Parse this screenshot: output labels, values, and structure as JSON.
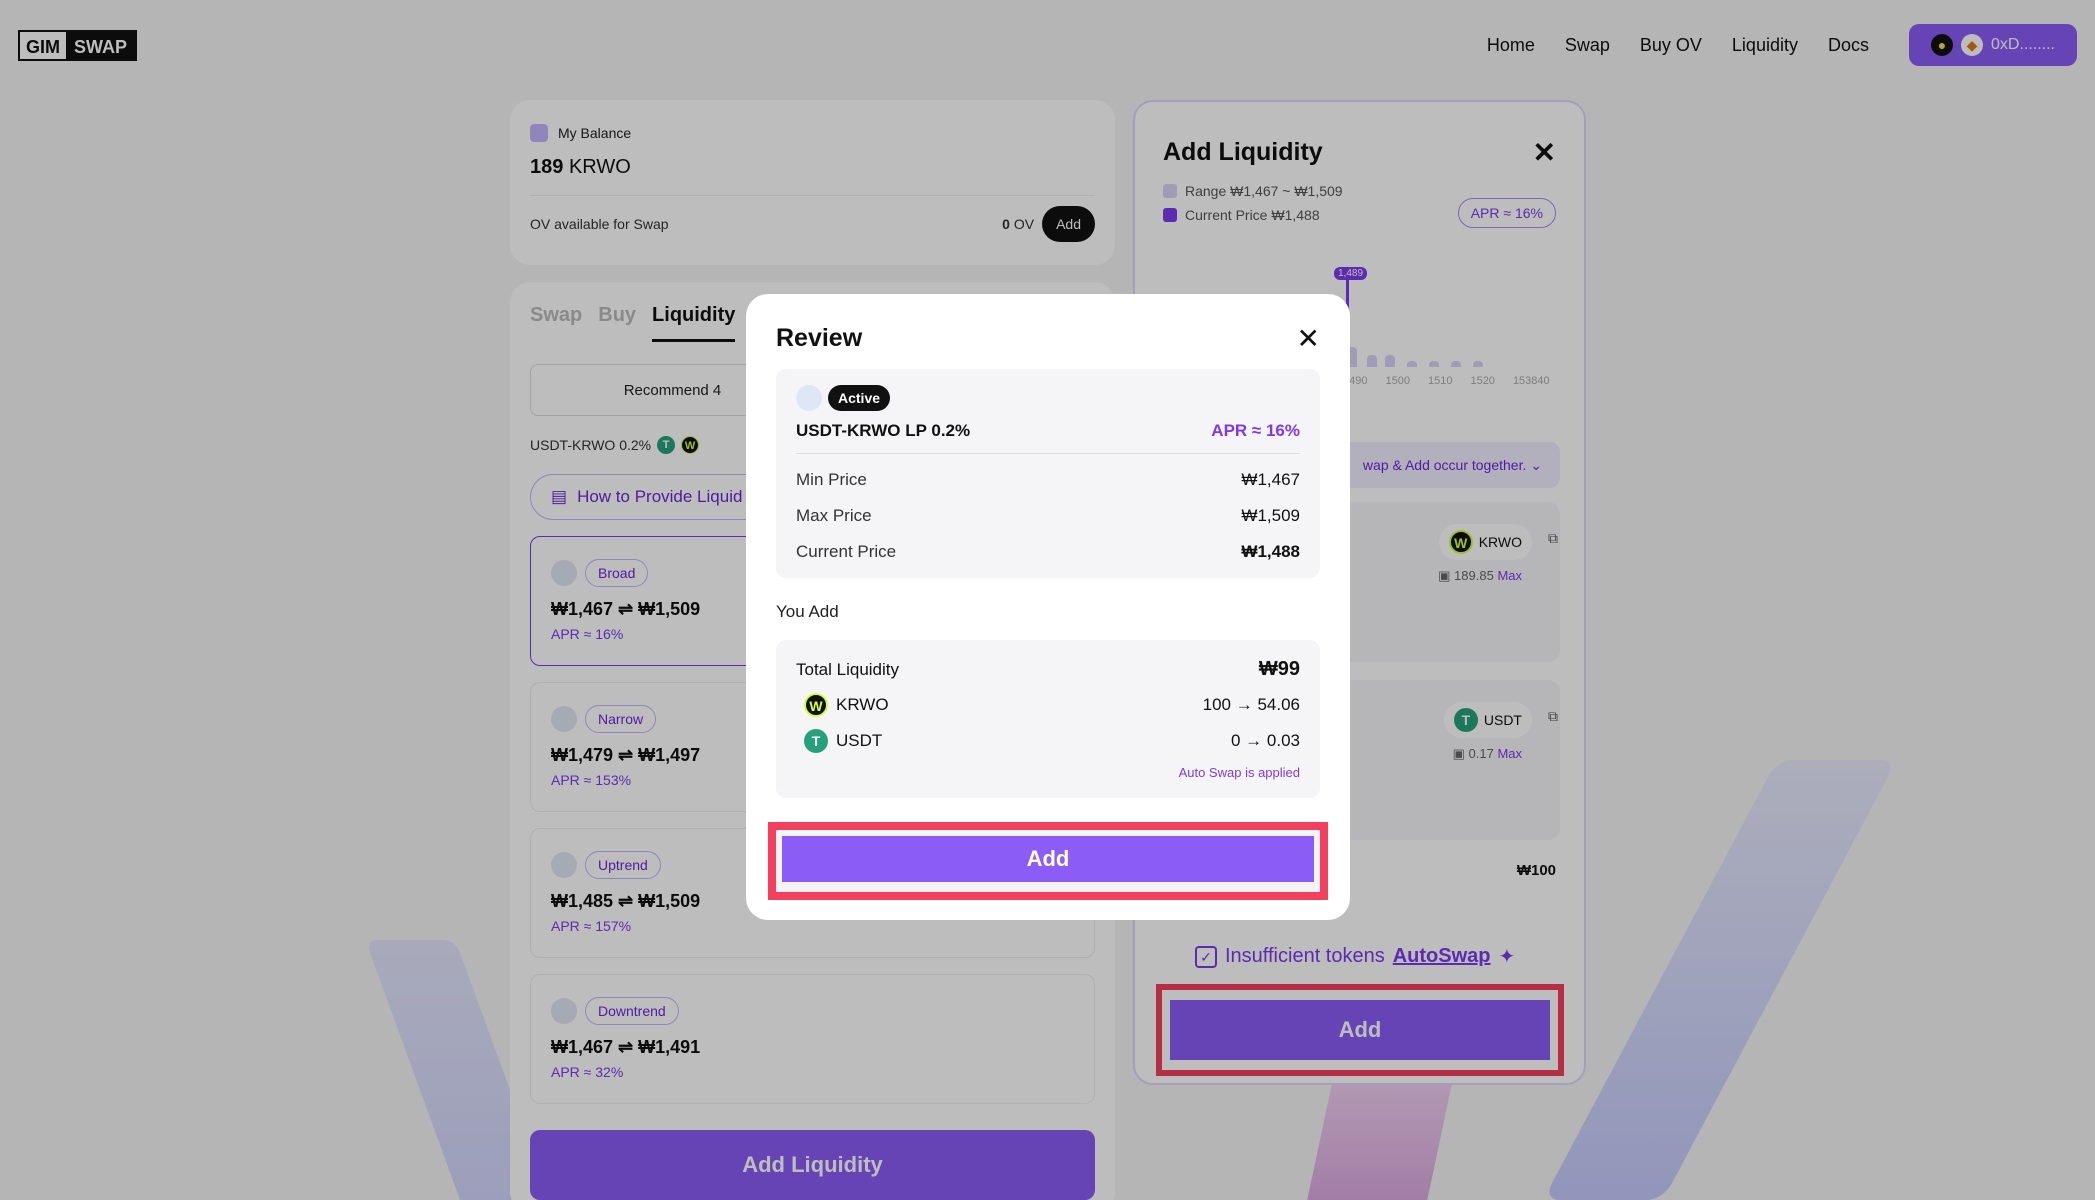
{
  "brand": {
    "part1": "GIM",
    "part2": "SWAP"
  },
  "nav": {
    "items": [
      "Home",
      "Swap",
      "Buy OV",
      "Liquidity",
      "Docs"
    ],
    "wallet": "0xD........"
  },
  "balance": {
    "label": "My Balance",
    "amount": "189",
    "unit": "KRWO",
    "ov_label": "OV available for Swap",
    "ov_value": "0",
    "ov_unit": "OV",
    "add": "Add"
  },
  "tabs": [
    "Swap",
    "Buy",
    "Liquidity"
  ],
  "recommend": "Recommend 4",
  "pair": "USDT-KRWO 0.2%",
  "howto": "How to Provide Liquid",
  "strategies": [
    {
      "tag": "Broad",
      "range": "₩1,467 ⇌ ₩1,509",
      "apr": "APR ≈ 16%"
    },
    {
      "tag": "Narrow",
      "range": "₩1,479 ⇌ ₩1,497",
      "apr": "APR ≈ 153%"
    },
    {
      "tag": "Uptrend",
      "range": "₩1,485 ⇌ ₩1,509",
      "apr": "APR ≈ 157%"
    },
    {
      "tag": "Downtrend",
      "range": "₩1,467 ⇌ ₩1,491",
      "apr": "APR ≈ 32%"
    }
  ],
  "add_liquidity_btn": "Add Liquidity",
  "side": {
    "title": "Add Liquidity",
    "range": "Range ₩1,467 ~ ₩1,509",
    "current": "Current Price ₩1,488",
    "apr": "APR ≈ 16%",
    "marker": "1,489",
    "ticks": [
      "1490",
      "1500",
      "1510",
      "1520",
      "153840"
    ],
    "autoswap_text": "wap & Add occur together.",
    "krwo": {
      "name": "KRWO",
      "bal": "189.85",
      "max": "Max"
    },
    "usdt": {
      "name": "USDT",
      "bal": "0.17",
      "max": "Max"
    },
    "total": "₩100",
    "p_text": "ap",
    "insufficient": "Insufficient tokens",
    "autoswap": "AutoSwap",
    "add": "Add"
  },
  "review": {
    "title": "Review",
    "status": "Active",
    "pool": "USDT-KRWO LP 0.2%",
    "apr": "APR ≈ 16%",
    "rows": [
      {
        "label": "Min Price",
        "value": "₩1,467"
      },
      {
        "label": "Max Price",
        "value": "₩1,509"
      },
      {
        "label": "Current Price",
        "value": "₩1,488"
      }
    ],
    "you_add": "You Add",
    "total_label": "Total Liquidity",
    "total_value": "₩99",
    "tokens": [
      {
        "name": "KRWO",
        "change": "100 → 54.06"
      },
      {
        "name": "USDT",
        "change": "0 → 0.03"
      }
    ],
    "auto_note": "Auto Swap is applied",
    "add": "Add"
  },
  "colors": {
    "accent": "#8b5cf6",
    "highlight": "#f43f5e"
  }
}
